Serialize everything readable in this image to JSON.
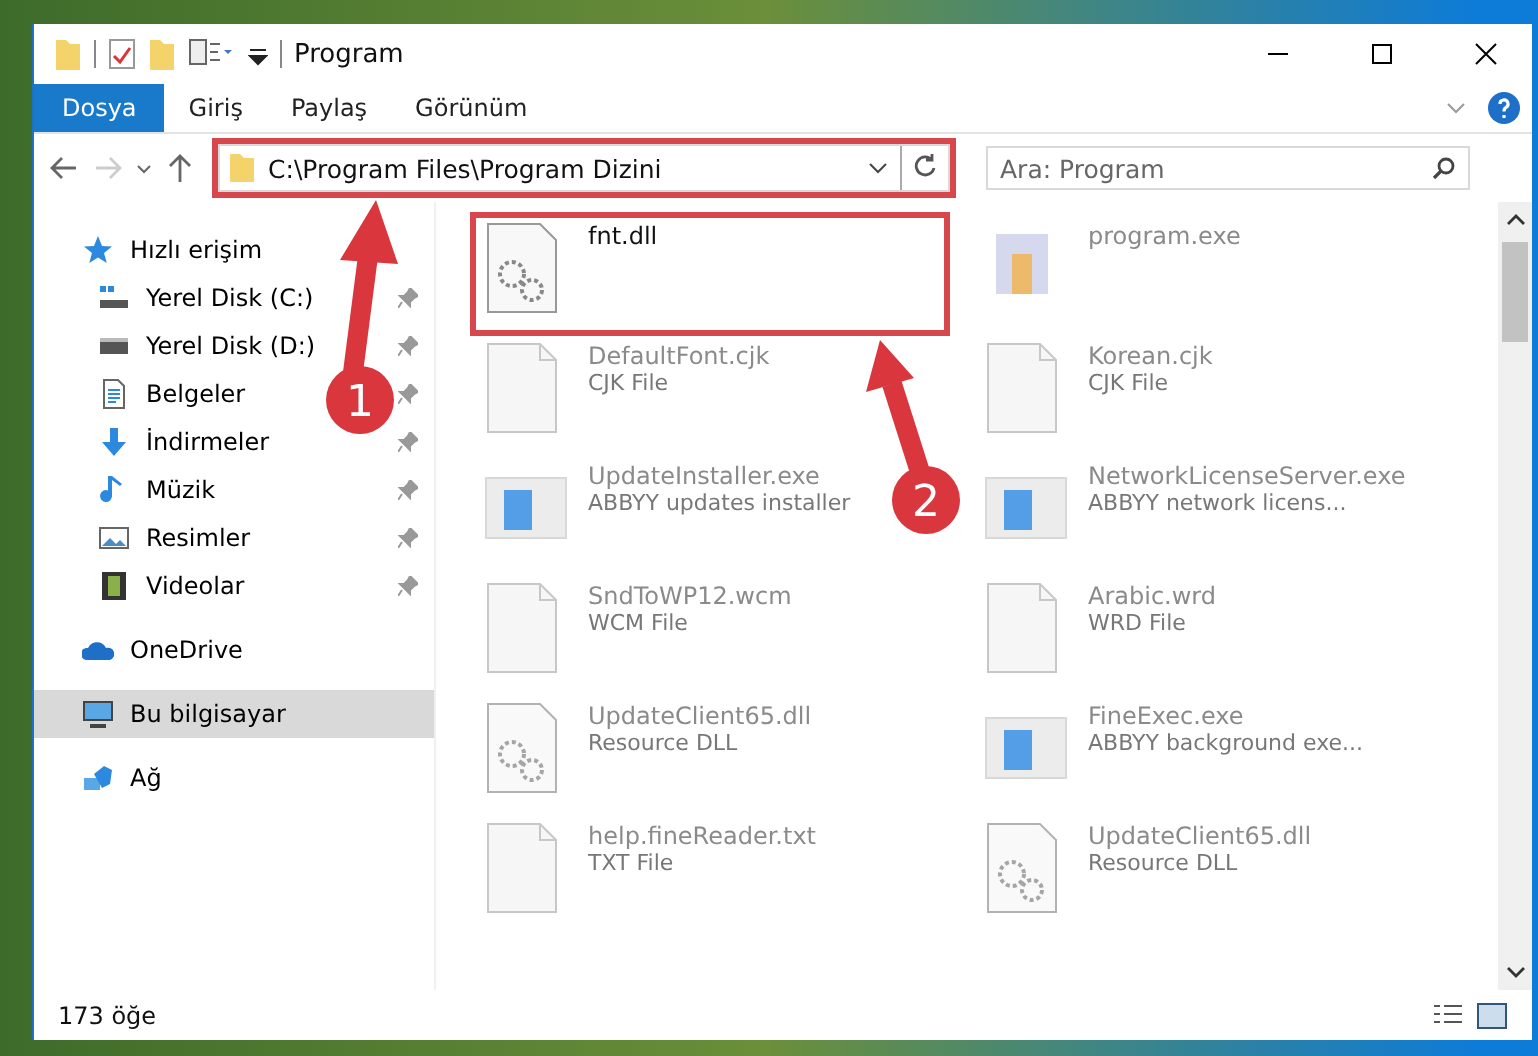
{
  "window": {
    "title": "Program"
  },
  "ribbon_tabs": [
    {
      "label": "Dosya",
      "selected": true
    },
    {
      "label": "Giriş",
      "selected": false
    },
    {
      "label": "Paylaş",
      "selected": false
    },
    {
      "label": "Görünüm",
      "selected": false
    }
  ],
  "address_bar": {
    "path": "C:\\Program Files\\Program Dizini",
    "highlighted": true
  },
  "search": {
    "placeholder": "Ara: Program"
  },
  "nav_pane": {
    "items": [
      {
        "label": "Hızlı erişim",
        "kind": "star",
        "pinned": false,
        "selected": false,
        "children": [
          {
            "label": "Yerel Disk (C:)",
            "kind": "sysdrive",
            "pinned": true,
            "selected": false
          },
          {
            "label": "Yerel Disk (D:)",
            "kind": "drive",
            "pinned": true,
            "selected": false
          },
          {
            "label": "Belgeler",
            "kind": "docs",
            "pinned": true,
            "selected": false
          },
          {
            "label": "İndirmeler",
            "kind": "download",
            "pinned": true,
            "selected": false
          },
          {
            "label": "Müzik",
            "kind": "music",
            "pinned": true,
            "selected": false
          },
          {
            "label": "Resimler",
            "kind": "pictures",
            "pinned": true,
            "selected": false
          },
          {
            "label": "Videolar",
            "kind": "video",
            "pinned": true,
            "selected": false
          }
        ]
      },
      {
        "label": "OneDrive",
        "kind": "cloud",
        "pinned": false,
        "selected": false
      },
      {
        "label": "Bu bilgisayar",
        "kind": "pc",
        "pinned": false,
        "selected": true
      },
      {
        "label": "Ağ",
        "kind": "network",
        "pinned": false,
        "selected": false
      }
    ]
  },
  "files": [
    {
      "name": "fnt.dll",
      "kind": "dll",
      "dimmed": false,
      "highlighted": true
    },
    {
      "name": "program.exe",
      "kind": "setup",
      "dimmed": true,
      "highlighted": false
    },
    {
      "name": "DefaultFont.cjk",
      "type": "CJK File",
      "kind": "blank",
      "dimmed": true,
      "highlighted": false
    },
    {
      "name": "Korean.cjk",
      "type": "CJK File",
      "kind": "blank",
      "dimmed": true,
      "highlighted": false
    },
    {
      "name": "UpdateInstaller.exe",
      "type": "ABBYY updates installer",
      "kind": "exe",
      "dimmed": true,
      "highlighted": false
    },
    {
      "name": "NetworkLicenseServer.exe",
      "type": "ABBYY network licens...",
      "kind": "exe",
      "dimmed": true,
      "highlighted": false
    },
    {
      "name": "SndToWP12.wcm",
      "type": "WCM File",
      "kind": "blank",
      "dimmed": true,
      "highlighted": false
    },
    {
      "name": "Arabic.wrd",
      "type": "WRD File",
      "kind": "blank",
      "dimmed": true,
      "highlighted": false
    },
    {
      "name": "UpdateClient65.dll",
      "type": "Resource DLL",
      "kind": "dll",
      "dimmed": true,
      "highlighted": false
    },
    {
      "name": "FineExec.exe",
      "type": "ABBYY background exe...",
      "kind": "exe",
      "dimmed": true,
      "highlighted": false
    },
    {
      "name": "help.fineReader.txt",
      "type": "TXT File",
      "kind": "blank",
      "dimmed": true,
      "highlighted": false
    },
    {
      "name": "UpdateClient65.dll",
      "type": "Resource DLL",
      "kind": "dll",
      "dimmed": true,
      "highlighted": false
    }
  ],
  "status_bar": {
    "item_count": "173 öğe"
  },
  "annotations": [
    {
      "label": "1"
    },
    {
      "label": "2"
    }
  ]
}
